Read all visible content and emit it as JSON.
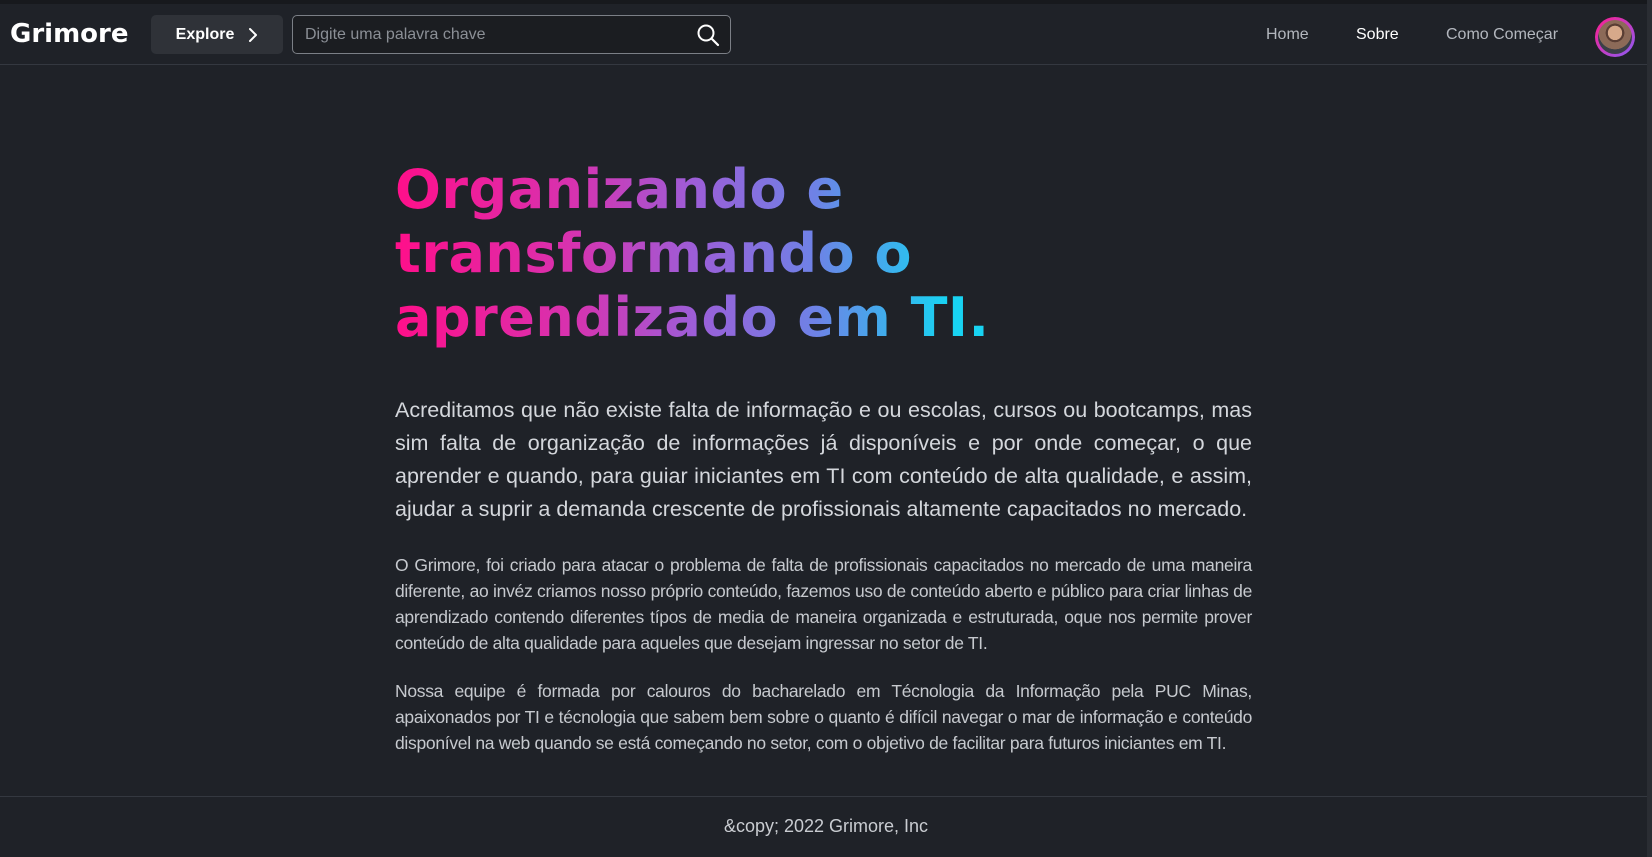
{
  "header": {
    "logo": "Grimore",
    "explore_label": "Explore",
    "search_placeholder": "Digite uma palavra chave",
    "search_value": "",
    "nav": [
      {
        "label": "Home",
        "active": false
      },
      {
        "label": "Sobre",
        "active": true
      },
      {
        "label": "Como Começar",
        "active": false
      }
    ]
  },
  "main": {
    "headline": "Organizando e transformando o aprendizado em TI.",
    "lead": "Acreditamos que não existe falta de informação e ou escolas, cursos ou bootcamps, mas sim falta de organização de informações já disponíveis e por onde começar, o que aprender e quando, para guiar iniciantes em TI com conteúdo de alta qualidade, e assim, ajudar a suprir a demanda crescente de profissionais altamente capacitados no mercado.",
    "paragraphs": [
      "O Grimore, foi criado para atacar o problema de falta de profissionais capacitados no mercado de uma maneira diferente, ao invéz criamos nosso próprio conteúdo, fazemos uso de conteúdo aberto e público para criar linhas de aprendizado contendo diferentes típos de media de maneira organizada e estruturada, oque nos permite prover conteúdo de alta qualidade para aqueles que desejam ingressar no setor de TI.",
      "Nossa equipe é formada por calouros do bacharelado em Técnologia da Informação pela PUC Minas, apaixonados por TI e técnologia que sabem bem sobre o quanto é difícil navegar o mar de informação e conteúdo disponível na web quando se está começando no setor, com o objetivo de facilitar para futuros iniciantes em TI."
    ]
  },
  "footer": {
    "text": "&copy; 2022 Grimore, Inc"
  },
  "colors": {
    "background": "#1f2228",
    "gradient_start": "#ff0f8a",
    "gradient_mid": "#9c5ed8",
    "gradient_end": "#18d3f2"
  },
  "icons": {
    "explore": "chevron-right-icon",
    "search": "search-icon",
    "avatar": "user-avatar"
  }
}
